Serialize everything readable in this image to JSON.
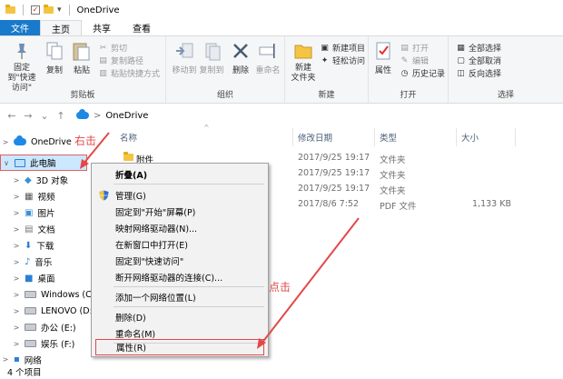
{
  "titlebar": {
    "title": "OneDrive",
    "dropdown_glyph": "▾",
    "check_glyph": "✓"
  },
  "tabs": [
    "文件",
    "主页",
    "共享",
    "查看"
  ],
  "ribbon": {
    "clipboard": {
      "label": "剪贴板",
      "pin": "固定到\"快速访问\"",
      "copy": "复制",
      "paste": "粘贴",
      "cut": "剪切",
      "copy_path": "复制路径",
      "paste_shortcut": "粘贴快捷方式"
    },
    "organize": {
      "label": "组织",
      "move_to": "移动到",
      "copy_to": "复制到",
      "delete": "删除",
      "rename": "重命名"
    },
    "new": {
      "label": "新建",
      "new_folder": "新建\n文件夹",
      "new_item": "新建项目",
      "easy_access": "轻松访问"
    },
    "open": {
      "label": "打开",
      "properties": "属性",
      "open": "打开",
      "edit": "编辑",
      "history": "历史记录"
    },
    "select": {
      "label": "选择",
      "select_all": "全部选择",
      "select_none": "全部取消",
      "invert": "反向选择"
    }
  },
  "address": {
    "path": "OneDrive",
    "path_sep": ">",
    "back": "←",
    "forward": "→",
    "recent": "⌄",
    "up": "↑"
  },
  "tree": {
    "expand_glyph": ">",
    "expanded_glyph": "∨",
    "items": [
      {
        "label": "OneDrive"
      },
      {
        "label": "此电脑"
      },
      {
        "label": "3D 对象"
      },
      {
        "label": "视频"
      },
      {
        "label": "图片"
      },
      {
        "label": "文档"
      },
      {
        "label": "下载"
      },
      {
        "label": "音乐"
      },
      {
        "label": "桌面"
      },
      {
        "label": "Windows (C:)"
      },
      {
        "label": "LENOVO (D:)"
      },
      {
        "label": "办公 (E:)"
      },
      {
        "label": "娱乐 (F:)"
      },
      {
        "label": "网络"
      }
    ]
  },
  "columns": {
    "name": "名称",
    "modified": "修改日期",
    "type": "类型",
    "size": "大小",
    "sort_glyph": "^"
  },
  "files": [
    {
      "name": "附件",
      "modified": "2017/9/25 19:17",
      "type": "文件夹",
      "size": ""
    },
    {
      "name": "",
      "modified": "2017/9/25 19:17",
      "type": "文件夹",
      "size": ""
    },
    {
      "name": "",
      "modified": "2017/9/25 19:17",
      "type": "文件夹",
      "size": ""
    },
    {
      "name": "",
      "modified": "2017/8/6 7:52",
      "type": "PDF 文件",
      "size": "1,133 KB"
    }
  ],
  "status": {
    "count": "4 个项目"
  },
  "context_menu": {
    "collapse": "折叠(A)",
    "manage": "管理(G)",
    "pin_start": "固定到\"开始\"屏幕(P)",
    "map_drive": "映射网络驱动器(N)...",
    "open_new_window": "在新窗口中打开(E)",
    "pin_quick": "固定到\"快速访问\"",
    "disconnect": "断开网络驱动器的连接(C)...",
    "add_network": "添加一个网络位置(L)",
    "delete": "删除(D)",
    "rename": "重命名(M)",
    "properties": "属性(R)"
  },
  "annotations": {
    "right_click": "右击",
    "click": "点击"
  },
  "colors": {
    "accent": "#1979ca",
    "annotation": "#e34848",
    "selection": "#cce8ff"
  }
}
